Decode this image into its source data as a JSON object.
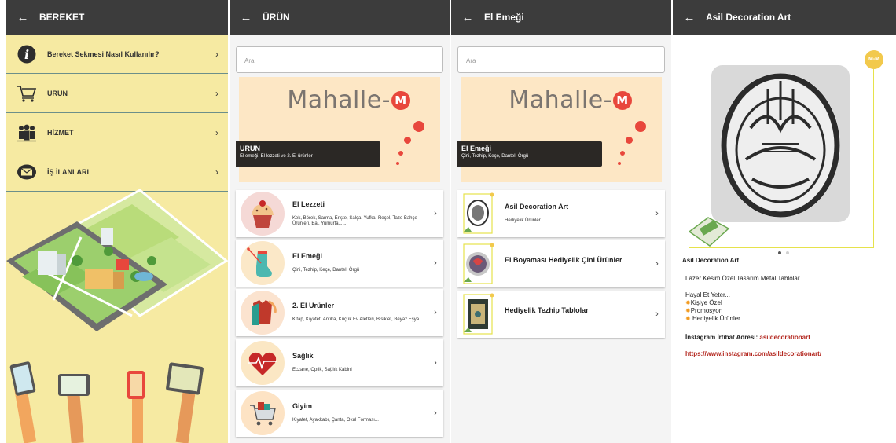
{
  "panel1": {
    "title": "BEREKET",
    "items": [
      {
        "label": "Bereket Sekmesi Nasıl Kullanılır?",
        "icon": "info-icon"
      },
      {
        "label": "ÜRÜN",
        "icon": "cart-icon"
      },
      {
        "label": "HİZMET",
        "icon": "people-icon"
      },
      {
        "label": "İŞ İLANLARI",
        "icon": "envelope-icon"
      }
    ]
  },
  "panel2": {
    "title": "ÜRÜN",
    "search_placeholder": "Ara",
    "logo_text": "Mahalle-",
    "logo_badge": "M",
    "banner_title": "ÜRÜN",
    "banner_subtitle": "El emeği, El lezzeti ve 2. El ürünler",
    "items": [
      {
        "title": "El Lezzeti",
        "subtitle": "Kek, Börek, Sarma, Erişte, Salça, Yufka, Reçel, Taze Bahçe Ürünleri, Bal, Yumurta... ...",
        "icon": "cupcake-icon"
      },
      {
        "title": "El Emeği",
        "subtitle": "Çini, Tezhip, Keçe, Dantel, Örgü",
        "icon": "knitting-icon"
      },
      {
        "title": "2. El Ürünler",
        "subtitle": "Kitap, Kıyafet, Antika, Küçük Ev Aletleri, Bisiklet, Beyaz Eşya...",
        "icon": "clothes-icon"
      },
      {
        "title": "Sağlık",
        "subtitle": "Eczane, Optik, Sağlık Kabini",
        "icon": "heart-icon"
      },
      {
        "title": "Giyim",
        "subtitle": "Kıyafet, Ayakkabı, Çanta, Okul Forması...",
        "icon": "shopping-cart-icon"
      }
    ]
  },
  "panel3": {
    "title": "El Emeği",
    "search_placeholder": "Ara",
    "logo_text": "Mahalle-",
    "logo_badge": "M",
    "banner_title": "El Emeği",
    "banner_subtitle": "Çini, Tezhip, Keçe, Dantel, Örgü",
    "items": [
      {
        "title": "Asil Decoration Art",
        "subtitle": "Hediyelik Ürünler"
      },
      {
        "title": "El Boyaması Hediyelik Çini Ürünler",
        "subtitle": ""
      },
      {
        "title": "Hediyelik Tezhip Tablolar",
        "subtitle": ""
      }
    ]
  },
  "panel4": {
    "title": "Asil Decoration Art",
    "badge": "M-M",
    "name": "Asil Decoration Art",
    "desc": "Lazer Kesim Özel Tasarım Metal Tablolar",
    "slogan": "Hayal Et Yeter...",
    "bullets": [
      "Kişiye Özel",
      "Promosyon",
      "Hediyelik Ürünler"
    ],
    "insta_label": "İnstagram İrtibat Adresi:",
    "insta_handle": "asildecorationart",
    "insta_url": "https://www.instagram.com/asildecorationart/"
  },
  "colors": {
    "topbar": "#3c3c3c",
    "panel1_bg": "#f6eaa2",
    "accent_red": "#e8473c",
    "link_red": "#b3261e",
    "frame_yellow": "#e6e24b"
  }
}
